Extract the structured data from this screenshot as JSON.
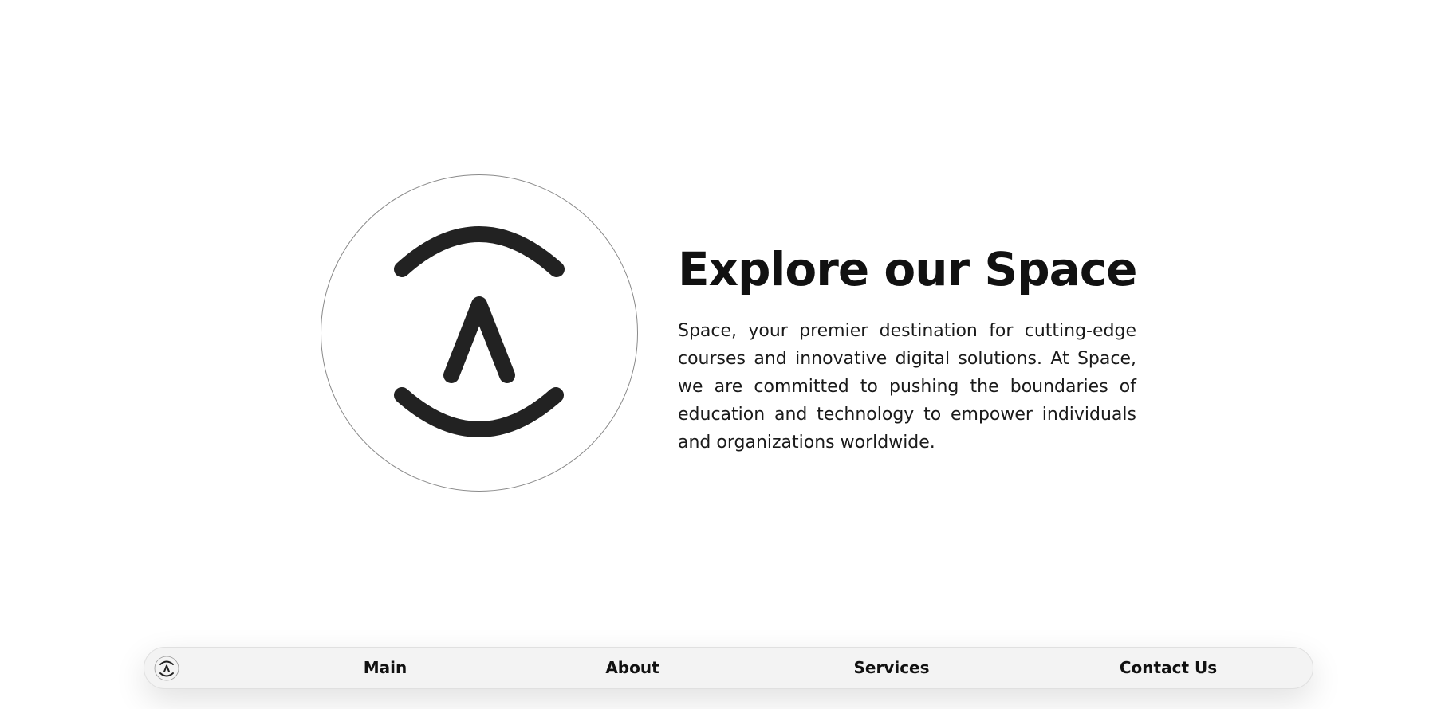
{
  "hero": {
    "title": "Explore our Space",
    "description": "Space, your premier destination for cutting-edge courses and innovative digital solutions. At Space, we are committed to pushing the boundaries of education and technology to empower individuals and organizations worldwide."
  },
  "logo": {
    "icon": "space-logo-icon",
    "color": "#222222"
  },
  "nav": {
    "items": [
      {
        "label": "Main"
      },
      {
        "label": "About"
      },
      {
        "label": "Services"
      },
      {
        "label": "Contact Us"
      }
    ]
  },
  "colors": {
    "background": "#ffffff",
    "text": "#111111",
    "navbar_background": "#f3f3f3"
  }
}
